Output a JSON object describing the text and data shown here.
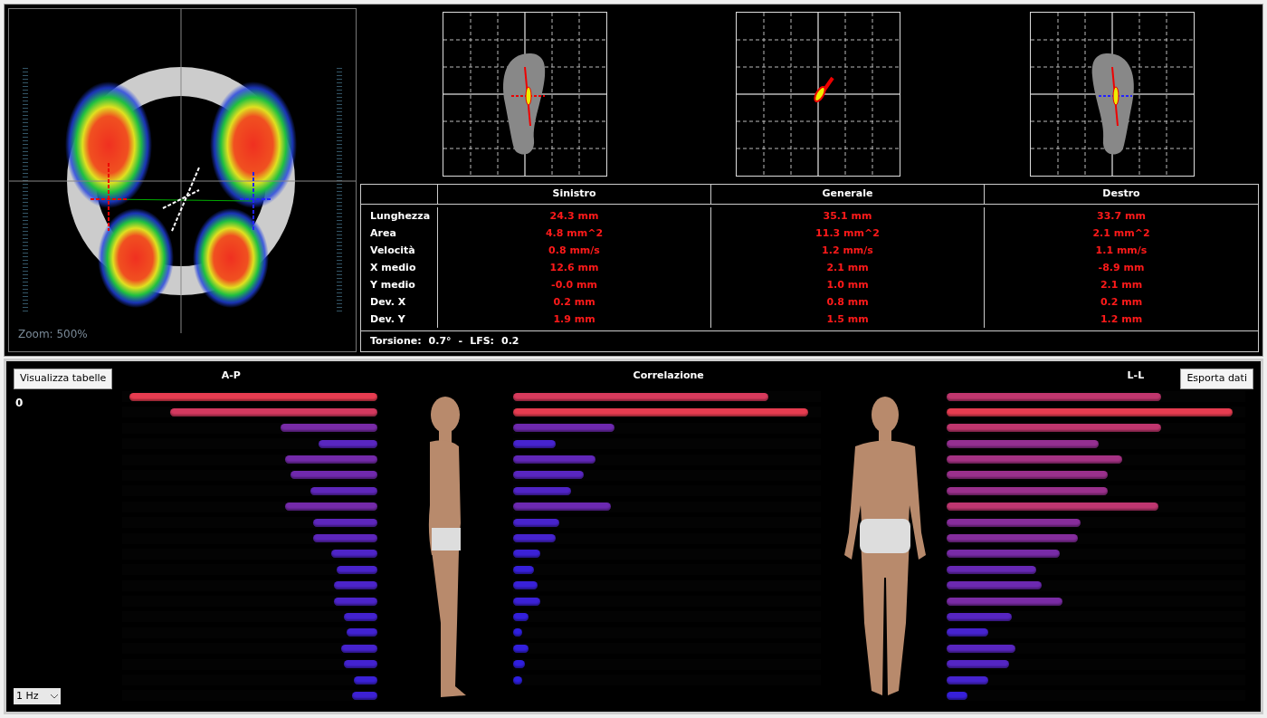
{
  "posturography": {
    "zoom_label": "Zoom: 500%"
  },
  "table": {
    "columns": [
      "Sinistro",
      "Generale",
      "Destro"
    ],
    "rows": [
      {
        "label": "Lunghezza",
        "values": [
          "24.3 mm",
          "35.1 mm",
          "33.7 mm"
        ]
      },
      {
        "label": "Area",
        "values": [
          "4.8 mm^2",
          "11.3 mm^2",
          "2.1 mm^2"
        ]
      },
      {
        "label": "Velocità",
        "values": [
          "0.8 mm/s",
          "1.2 mm/s",
          "1.1 mm/s"
        ]
      },
      {
        "label": "X medio",
        "values": [
          "12.6 mm",
          "2.1 mm",
          "-8.9 mm"
        ]
      },
      {
        "label": "Y medio",
        "values": [
          "-0.0 mm",
          "1.0 mm",
          "2.1 mm"
        ]
      },
      {
        "label": "Dev. X",
        "values": [
          "0.2 mm",
          "0.8 mm",
          "0.2 mm"
        ]
      },
      {
        "label": "Dev. Y",
        "values": [
          "1.9 mm",
          "1.5 mm",
          "1.2 mm"
        ]
      }
    ],
    "footer": {
      "torsion_label": "Torsione:",
      "torsion": "0.7°",
      "separator": "-",
      "lfs_label": "LFS:",
      "lfs": "0.2"
    }
  },
  "bottom": {
    "show_tables_button": "Visualizza tabelle",
    "export_button": "Esporta dati",
    "counter": "0",
    "frequency": "1 Hz",
    "ap": {
      "title": "A-P",
      "bars": [
        {
          "level": 0.97
        },
        {
          "level": 0.81
        },
        {
          "level": 0.38
        },
        {
          "level": 0.23
        },
        {
          "level": 0.36
        },
        {
          "level": 0.34
        },
        {
          "level": 0.26
        },
        {
          "level": 0.36
        },
        {
          "level": 0.25
        },
        {
          "level": 0.25
        },
        {
          "level": 0.18
        },
        {
          "level": 0.16
        },
        {
          "level": 0.17
        },
        {
          "level": 0.17
        },
        {
          "level": 0.13
        },
        {
          "level": 0.12
        },
        {
          "level": 0.14
        },
        {
          "level": 0.13
        },
        {
          "level": 0.09
        },
        {
          "level": 0.1
        }
      ]
    },
    "correlation": {
      "title": "Correlazione",
      "bars": [
        {
          "level": 0.83
        },
        {
          "level": 0.96
        },
        {
          "level": 0.33
        },
        {
          "level": 0.14
        },
        {
          "level": 0.27
        },
        {
          "level": 0.23
        },
        {
          "level": 0.19
        },
        {
          "level": 0.32
        },
        {
          "level": 0.15
        },
        {
          "level": 0.14
        },
        {
          "level": 0.09
        },
        {
          "level": 0.07
        },
        {
          "level": 0.08
        },
        {
          "level": 0.09
        },
        {
          "level": 0.05
        },
        {
          "level": 0.03
        },
        {
          "level": 0.05
        },
        {
          "level": 0.04
        },
        {
          "level": 0.03
        }
      ]
    },
    "ll": {
      "title": "L-L",
      "bars": [
        {
          "level": 0.72
        },
        {
          "level": 0.96
        },
        {
          "level": 0.72
        },
        {
          "level": 0.51
        },
        {
          "level": 0.59
        },
        {
          "level": 0.54
        },
        {
          "level": 0.54
        },
        {
          "level": 0.71
        },
        {
          "level": 0.45
        },
        {
          "level": 0.44
        },
        {
          "level": 0.38
        },
        {
          "level": 0.3
        },
        {
          "level": 0.32
        },
        {
          "level": 0.39
        },
        {
          "level": 0.22
        },
        {
          "level": 0.14
        },
        {
          "level": 0.23
        },
        {
          "level": 0.21
        },
        {
          "level": 0.14
        },
        {
          "level": 0.07
        }
      ]
    }
  }
}
